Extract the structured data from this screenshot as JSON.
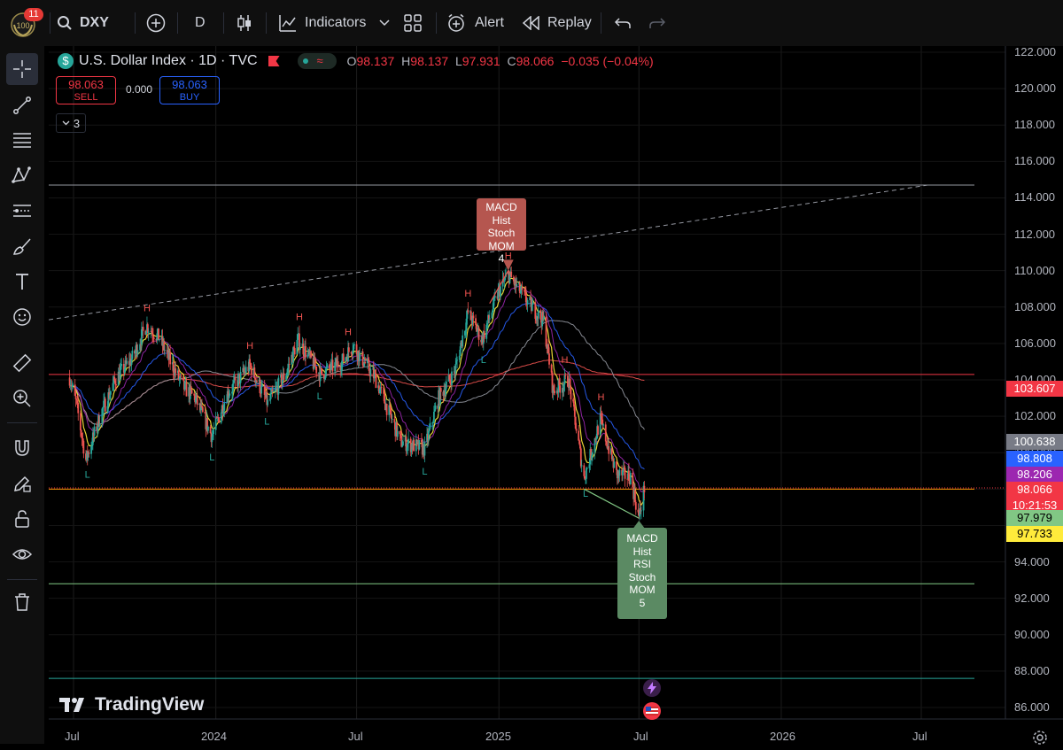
{
  "topbar": {
    "notification_count": "11",
    "symbol": "DXY",
    "interval": "D",
    "indicators_label": "Indicators",
    "alert_label": "Alert",
    "replay_label": "Replay"
  },
  "legend": {
    "title": "U.S. Dollar Index · 1D · TVC",
    "open_label": "O",
    "open": "98.137",
    "high_label": "H",
    "high": "98.137",
    "low_label": "L",
    "low": "97.931",
    "close_label": "C",
    "close": "98.066",
    "change": "−0.035 (−0.04%)",
    "sell_price": "98.063",
    "sell_label": "SELL",
    "spread": "0.000",
    "buy_price": "98.063",
    "buy_label": "BUY",
    "collapsed_count": "3"
  },
  "annotations": {
    "top_signal": [
      "MACD",
      "Hist",
      "Stoch",
      "MOM",
      "4"
    ],
    "bottom_signal": [
      "MACD",
      "Hist",
      "RSI",
      "Stoch",
      "MOM",
      "5"
    ]
  },
  "price_scale": {
    "ticks": [
      "122.000",
      "120.000",
      "118.000",
      "116.000",
      "114.000",
      "112.000",
      "110.000",
      "108.000",
      "106.000",
      "104.000",
      "102.000",
      "100.000",
      "98.000",
      "96.000",
      "94.000",
      "92.000",
      "90.000",
      "88.000",
      "86.000"
    ],
    "tags": [
      {
        "value": "103.607",
        "color": "#f23645"
      },
      {
        "value": "100.638",
        "color": "#787b86"
      },
      {
        "value": "98.808",
        "color": "#2962ff"
      },
      {
        "value": "98.206",
        "color": "#9c27b0"
      },
      {
        "value": "98.066",
        "color": "#f23645",
        "countdown": "10:21:53"
      },
      {
        "value": "97.979",
        "color": "#81c784"
      },
      {
        "value": "97.733",
        "color": "#ffeb3b"
      }
    ]
  },
  "time_scale": [
    "Jul",
    "2024",
    "Jul",
    "2025",
    "Jul",
    "2026",
    "Jul"
  ],
  "branding": "TradingView",
  "colors": {
    "up_candle": "#26a69a",
    "down_candle": "#ef5350",
    "price_line": "#f23645",
    "ema_fast": "#ffeb3b",
    "ema_mid": "#9c27b0",
    "ema_slow": "#2962ff"
  },
  "chart_data": {
    "type": "candlestick",
    "title": "U.S. Dollar Index · 1D · TVC",
    "ylim": [
      85,
      123
    ],
    "horizontal_levels": [
      114.7,
      104.3,
      98.0,
      92.8,
      87.6
    ],
    "price_path": [
      [
        "2023-06-25",
        104.3
      ],
      [
        "2023-07-05",
        102.6
      ],
      [
        "2023-07-17",
        99.6
      ],
      [
        "2023-08-05",
        102.1
      ],
      [
        "2023-08-25",
        104.1
      ],
      [
        "2023-09-15",
        105.2
      ],
      [
        "2023-10-03",
        107.0
      ],
      [
        "2023-10-20",
        106.3
      ],
      [
        "2023-11-03",
        105.0
      ],
      [
        "2023-11-20",
        103.6
      ],
      [
        "2023-12-05",
        103.0
      ],
      [
        "2023-12-27",
        100.9
      ],
      [
        "2024-01-15",
        103.2
      ],
      [
        "2024-02-14",
        104.8
      ],
      [
        "2024-03-08",
        102.7
      ],
      [
        "2024-04-01",
        104.4
      ],
      [
        "2024-04-16",
        106.2
      ],
      [
        "2024-05-15",
        104.3
      ],
      [
        "2024-06-12",
        105.0
      ],
      [
        "2024-06-26",
        105.9
      ],
      [
        "2024-07-25",
        104.1
      ],
      [
        "2024-08-27",
        100.6
      ],
      [
        "2024-09-27",
        100.2
      ],
      [
        "2024-10-15",
        103.0
      ],
      [
        "2024-11-05",
        104.5
      ],
      [
        "2024-11-22",
        107.7
      ],
      [
        "2024-12-10",
        106.2
      ],
      [
        "2024-12-31",
        108.8
      ],
      [
        "2025-01-13",
        109.8
      ],
      [
        "2025-02-03",
        108.5
      ],
      [
        "2025-02-28",
        107.2
      ],
      [
        "2025-03-12",
        103.4
      ],
      [
        "2025-04-01",
        104.0
      ],
      [
        "2025-04-21",
        98.6
      ],
      [
        "2025-05-12",
        101.8
      ],
      [
        "2025-06-02",
        98.8
      ],
      [
        "2025-06-20",
        98.7
      ],
      [
        "2025-07-01",
        96.4
      ],
      [
        "2025-07-08",
        98.06
      ]
    ],
    "annotations": [
      {
        "date": "2025-01-13",
        "text": [
          "MACD",
          "Hist",
          "Stoch",
          "MOM",
          "4"
        ]
      },
      {
        "date": "2025-07-01",
        "text": [
          "MACD",
          "Hist",
          "RSI",
          "Stoch",
          "MOM",
          "5"
        ]
      }
    ]
  }
}
